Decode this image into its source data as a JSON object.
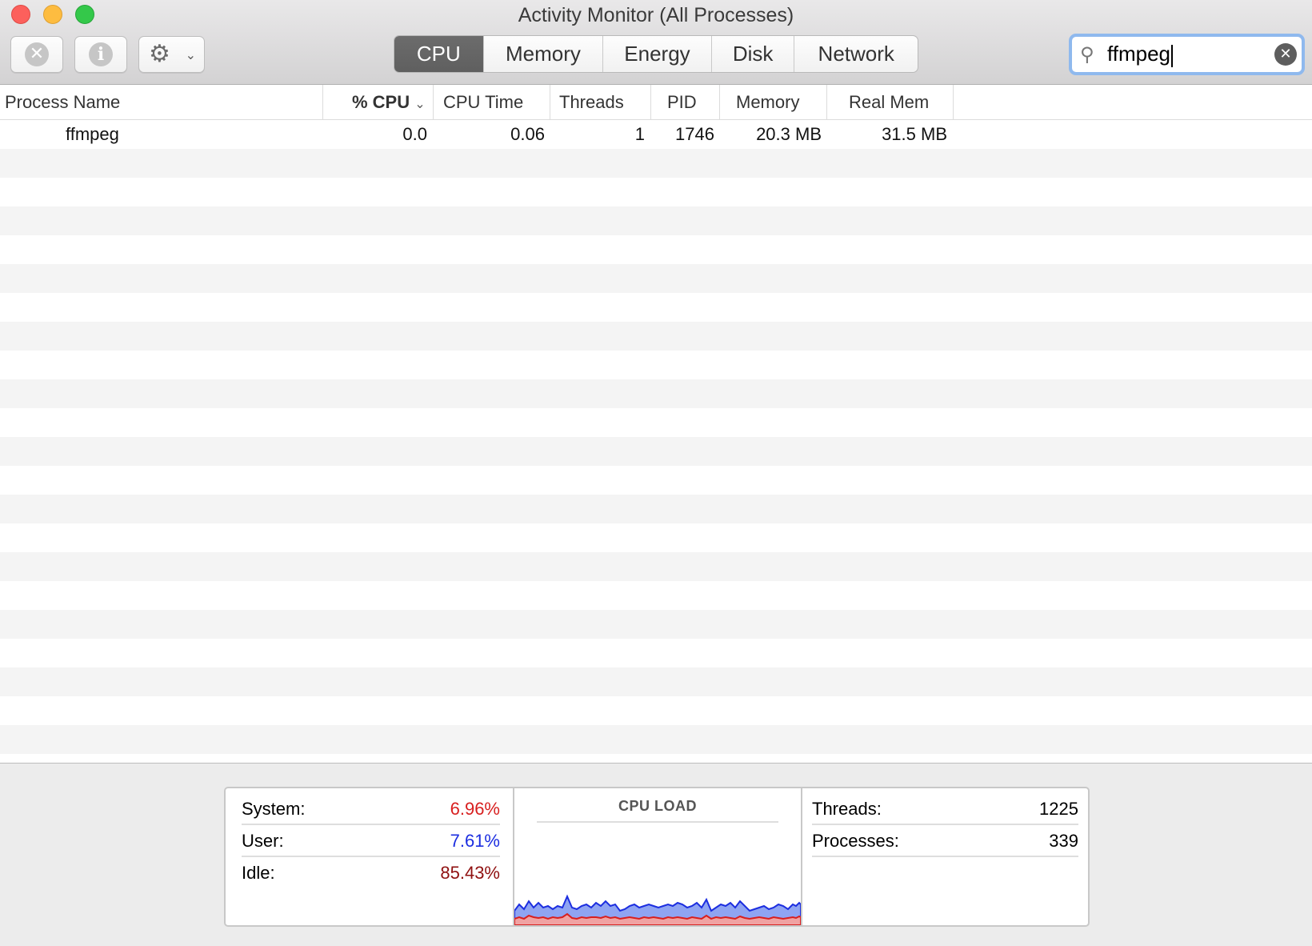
{
  "window": {
    "title": "Activity Monitor (All Processes)"
  },
  "toolbar": {
    "stop_icon": "x-circle-icon",
    "info_icon": "info-icon",
    "gear_icon": "gear-icon",
    "stop_glyph": "✕",
    "info_glyph": "i",
    "gear_glyph": "⚙",
    "chevron_glyph": "⌄"
  },
  "tabs": [
    {
      "label": "CPU",
      "active": true
    },
    {
      "label": "Memory",
      "active": false
    },
    {
      "label": "Energy",
      "active": false
    },
    {
      "label": "Disk",
      "active": false
    },
    {
      "label": "Network",
      "active": false
    }
  ],
  "search": {
    "value": "ffmpeg",
    "icon_glyph": "⚲",
    "clear_glyph": "✕"
  },
  "table": {
    "columns": [
      "Process Name",
      "% CPU",
      "CPU Time",
      "Threads",
      "PID",
      "Memory",
      "Real Mem"
    ],
    "sort_column": "% CPU",
    "sort_glyph": "⌄",
    "rows": [
      {
        "name": "ffmpeg",
        "cpu": "0.0",
        "cpu_time": "0.06",
        "threads": "1",
        "pid": "1746",
        "memory": "20.3 MB",
        "real_mem": "31.5 MB"
      }
    ]
  },
  "stats": {
    "system_label": "System:",
    "system_value": "6.96%",
    "system_color": "#d81f1f",
    "user_label": "User:",
    "user_value": "7.61%",
    "user_color": "#1c2ee0",
    "idle_label": "Idle:",
    "idle_value": "85.43%",
    "idle_color": "#8f1010",
    "cpu_load_title": "CPU LOAD",
    "threads_label": "Threads:",
    "threads_value": "1225",
    "processes_label": "Processes:",
    "processes_value": "339"
  }
}
